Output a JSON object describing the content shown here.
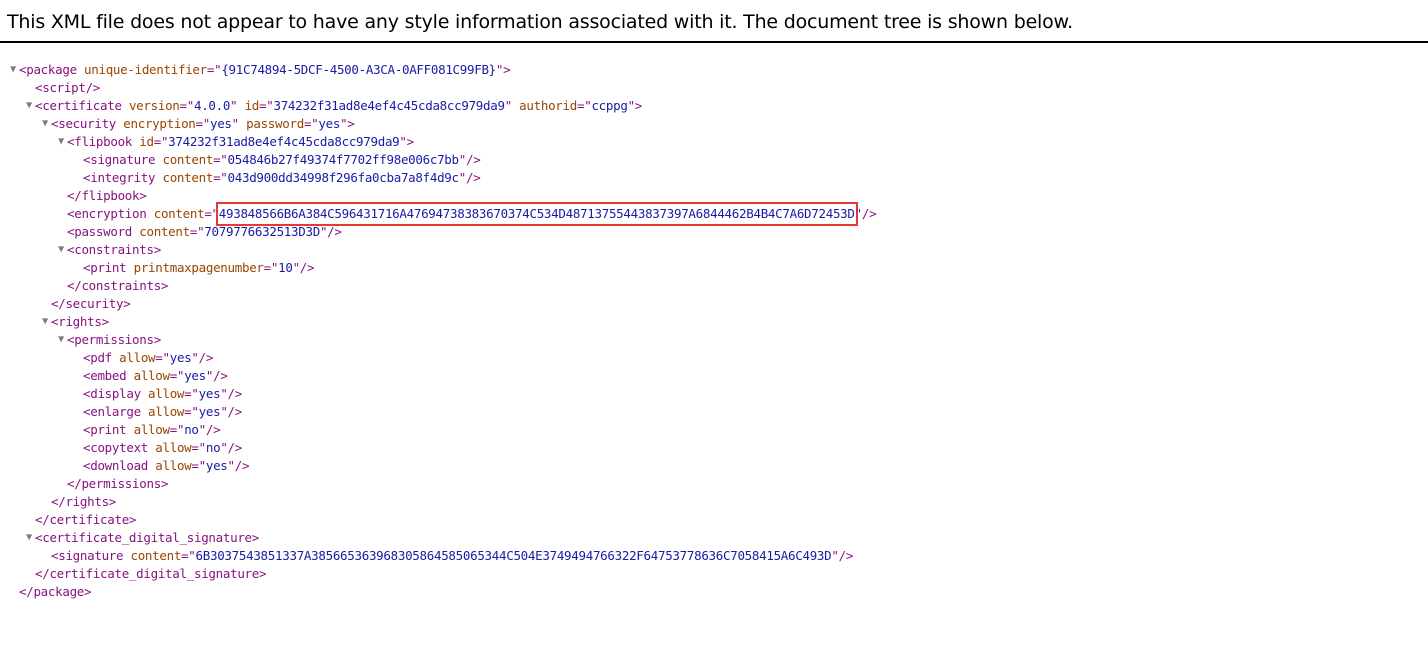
{
  "header": {
    "notice": "This XML file does not appear to have any style information associated with it. The document tree is shown below."
  },
  "toggle_glyph": "▼",
  "colors": {
    "tag": "#881280",
    "attr_name": "#994500",
    "attr_value": "#1a1aa6",
    "highlight": "#e53935"
  },
  "tree": [
    {
      "name": "xml-line",
      "indent": 0,
      "toggle": true,
      "parts": [
        [
          "tag",
          "<package "
        ],
        [
          "attr",
          "unique-identifier"
        ],
        [
          "tag",
          "=\""
        ],
        [
          "val",
          "{91C74894-5DCF-4500-A3CA-0AFF081C99FB}"
        ],
        [
          "tag",
          "\">"
        ]
      ]
    },
    {
      "name": "xml-line",
      "indent": 1,
      "toggle": false,
      "parts": [
        [
          "tag",
          "<script/>"
        ]
      ]
    },
    {
      "name": "xml-line",
      "indent": 1,
      "toggle": true,
      "parts": [
        [
          "tag",
          "<certificate "
        ],
        [
          "attr",
          "version"
        ],
        [
          "tag",
          "=\""
        ],
        [
          "val",
          "4.0.0"
        ],
        [
          "tag",
          "\" "
        ],
        [
          "attr",
          "id"
        ],
        [
          "tag",
          "=\""
        ],
        [
          "val",
          "374232f31ad8e4ef4c45cda8cc979da9"
        ],
        [
          "tag",
          "\" "
        ],
        [
          "attr",
          "authorid"
        ],
        [
          "tag",
          "=\""
        ],
        [
          "val",
          "ccppg"
        ],
        [
          "tag",
          "\">"
        ]
      ]
    },
    {
      "name": "xml-line",
      "indent": 2,
      "toggle": true,
      "parts": [
        [
          "tag",
          "<security "
        ],
        [
          "attr",
          "encryption"
        ],
        [
          "tag",
          "=\""
        ],
        [
          "val",
          "yes"
        ],
        [
          "tag",
          "\" "
        ],
        [
          "attr",
          "password"
        ],
        [
          "tag",
          "=\""
        ],
        [
          "val",
          "yes"
        ],
        [
          "tag",
          "\">"
        ]
      ]
    },
    {
      "name": "xml-line",
      "indent": 3,
      "toggle": true,
      "parts": [
        [
          "tag",
          "<flipbook "
        ],
        [
          "attr",
          "id"
        ],
        [
          "tag",
          "=\""
        ],
        [
          "val",
          "374232f31ad8e4ef4c45cda8cc979da9"
        ],
        [
          "tag",
          "\">"
        ]
      ]
    },
    {
      "name": "xml-line",
      "indent": 4,
      "toggle": false,
      "parts": [
        [
          "tag",
          "<signature "
        ],
        [
          "attr",
          "content"
        ],
        [
          "tag",
          "=\""
        ],
        [
          "val",
          "054846b27f49374f7702ff98e006c7bb"
        ],
        [
          "tag",
          "\"/>"
        ]
      ]
    },
    {
      "name": "xml-line",
      "indent": 4,
      "toggle": false,
      "parts": [
        [
          "tag",
          "<integrity "
        ],
        [
          "attr",
          "content"
        ],
        [
          "tag",
          "=\""
        ],
        [
          "val",
          "043d900dd34998f296fa0cba7a8f4d9c"
        ],
        [
          "tag",
          "\"/>"
        ]
      ]
    },
    {
      "name": "xml-line",
      "indent": 3,
      "toggle": false,
      "parts": [
        [
          "tag",
          "</flipbook>"
        ]
      ]
    },
    {
      "name": "xml-line",
      "indent": 3,
      "toggle": false,
      "parts": [
        [
          "tag",
          "<encryption "
        ],
        [
          "attr",
          "content"
        ],
        [
          "tag",
          "=\""
        ],
        [
          "hl",
          "493848566B6A384C596431716A47694738383670374C534D48713755443837397A6844462B4B4C7A6D72453D"
        ],
        [
          "tag",
          "\"/>"
        ]
      ]
    },
    {
      "name": "xml-line",
      "indent": 3,
      "toggle": false,
      "parts": [
        [
          "tag",
          "<password "
        ],
        [
          "attr",
          "content"
        ],
        [
          "tag",
          "=\""
        ],
        [
          "val",
          "7079776632513D3D"
        ],
        [
          "tag",
          "\"/>"
        ]
      ]
    },
    {
      "name": "xml-line",
      "indent": 3,
      "toggle": true,
      "parts": [
        [
          "tag",
          "<constraints>"
        ]
      ]
    },
    {
      "name": "xml-line",
      "indent": 4,
      "toggle": false,
      "parts": [
        [
          "tag",
          "<print "
        ],
        [
          "attr",
          "printmaxpagenumber"
        ],
        [
          "tag",
          "=\""
        ],
        [
          "val",
          "10"
        ],
        [
          "tag",
          "\"/>"
        ]
      ]
    },
    {
      "name": "xml-line",
      "indent": 3,
      "toggle": false,
      "parts": [
        [
          "tag",
          "</constraints>"
        ]
      ]
    },
    {
      "name": "xml-line",
      "indent": 2,
      "toggle": false,
      "parts": [
        [
          "tag",
          "</security>"
        ]
      ]
    },
    {
      "name": "xml-line",
      "indent": 2,
      "toggle": true,
      "parts": [
        [
          "tag",
          "<rights>"
        ]
      ]
    },
    {
      "name": "xml-line",
      "indent": 3,
      "toggle": true,
      "parts": [
        [
          "tag",
          "<permissions>"
        ]
      ]
    },
    {
      "name": "xml-line",
      "indent": 4,
      "toggle": false,
      "parts": [
        [
          "tag",
          "<pdf "
        ],
        [
          "attr",
          "allow"
        ],
        [
          "tag",
          "=\""
        ],
        [
          "val",
          "yes"
        ],
        [
          "tag",
          "\"/>"
        ]
      ]
    },
    {
      "name": "xml-line",
      "indent": 4,
      "toggle": false,
      "parts": [
        [
          "tag",
          "<embed "
        ],
        [
          "attr",
          "allow"
        ],
        [
          "tag",
          "=\""
        ],
        [
          "val",
          "yes"
        ],
        [
          "tag",
          "\"/>"
        ]
      ]
    },
    {
      "name": "xml-line",
      "indent": 4,
      "toggle": false,
      "parts": [
        [
          "tag",
          "<display "
        ],
        [
          "attr",
          "allow"
        ],
        [
          "tag",
          "=\""
        ],
        [
          "val",
          "yes"
        ],
        [
          "tag",
          "\"/>"
        ]
      ]
    },
    {
      "name": "xml-line",
      "indent": 4,
      "toggle": false,
      "parts": [
        [
          "tag",
          "<enlarge "
        ],
        [
          "attr",
          "allow"
        ],
        [
          "tag",
          "=\""
        ],
        [
          "val",
          "yes"
        ],
        [
          "tag",
          "\"/>"
        ]
      ]
    },
    {
      "name": "xml-line",
      "indent": 4,
      "toggle": false,
      "parts": [
        [
          "tag",
          "<print "
        ],
        [
          "attr",
          "allow"
        ],
        [
          "tag",
          "=\""
        ],
        [
          "val",
          "no"
        ],
        [
          "tag",
          "\"/>"
        ]
      ]
    },
    {
      "name": "xml-line",
      "indent": 4,
      "toggle": false,
      "parts": [
        [
          "tag",
          "<copytext "
        ],
        [
          "attr",
          "allow"
        ],
        [
          "tag",
          "=\""
        ],
        [
          "val",
          "no"
        ],
        [
          "tag",
          "\"/>"
        ]
      ]
    },
    {
      "name": "xml-line",
      "indent": 4,
      "toggle": false,
      "parts": [
        [
          "tag",
          "<download "
        ],
        [
          "attr",
          "allow"
        ],
        [
          "tag",
          "=\""
        ],
        [
          "val",
          "yes"
        ],
        [
          "tag",
          "\"/>"
        ]
      ]
    },
    {
      "name": "xml-line",
      "indent": 3,
      "toggle": false,
      "parts": [
        [
          "tag",
          "</permissions>"
        ]
      ]
    },
    {
      "name": "xml-line",
      "indent": 2,
      "toggle": false,
      "parts": [
        [
          "tag",
          "</rights>"
        ]
      ]
    },
    {
      "name": "xml-line",
      "indent": 1,
      "toggle": false,
      "parts": [
        [
          "tag",
          "</certificate>"
        ]
      ]
    },
    {
      "name": "xml-line",
      "indent": 1,
      "toggle": true,
      "parts": [
        [
          "tag",
          "<certificate_digital_signature>"
        ]
      ]
    },
    {
      "name": "xml-line",
      "indent": 2,
      "toggle": false,
      "parts": [
        [
          "tag",
          "<signature "
        ],
        [
          "attr",
          "content"
        ],
        [
          "tag",
          "=\""
        ],
        [
          "val",
          "6B3037543851337A385665363968305864585065344C504E3749494766322F64753778636C7058415A6C493D"
        ],
        [
          "tag",
          "\"/>"
        ]
      ]
    },
    {
      "name": "xml-line",
      "indent": 1,
      "toggle": false,
      "parts": [
        [
          "tag",
          "</certificate_digital_signature>"
        ]
      ]
    },
    {
      "name": "xml-line",
      "indent": 0,
      "toggle": false,
      "parts": [
        [
          "tag",
          "</package>"
        ]
      ]
    }
  ]
}
